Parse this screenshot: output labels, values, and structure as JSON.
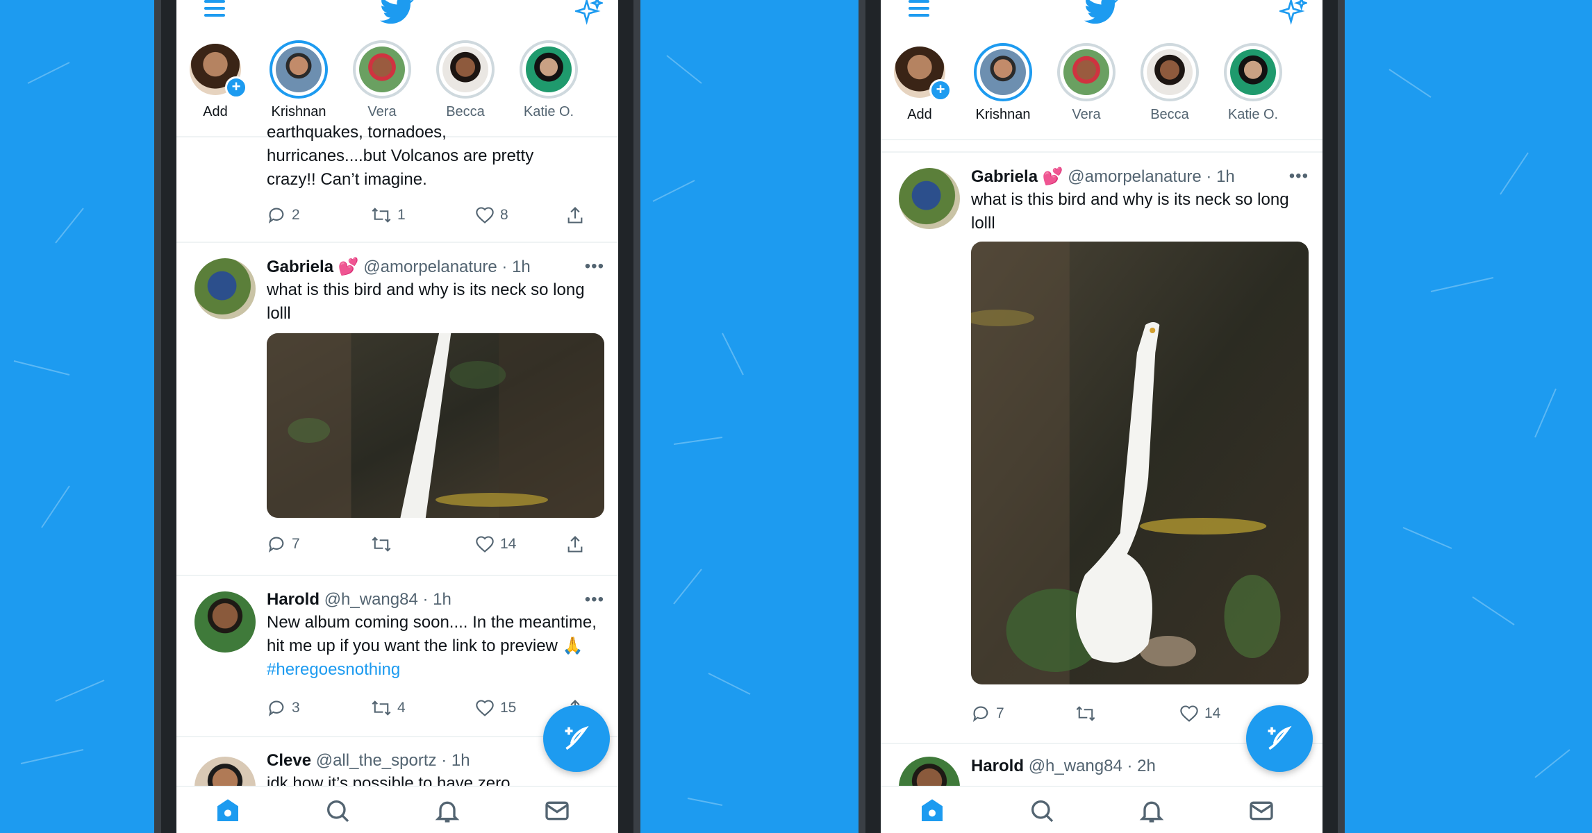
{
  "colors": {
    "brand": "#1d9bf0",
    "background": "#1d9bf0",
    "text": "#0f1419",
    "muted": "#536471"
  },
  "fleets": [
    {
      "name": "Add",
      "has_plus": true
    },
    {
      "name": "Krishnan"
    },
    {
      "name": "Vera"
    },
    {
      "name": "Becca"
    },
    {
      "name": "Katie O."
    }
  ],
  "left": {
    "partial_tweet": {
      "text": "earthquakes, tornadoes,\nhurricanes....but Volcanos are pretty\ncrazy!!  Can’t imagine.",
      "replies": "2",
      "retweets": "1",
      "likes": "8"
    },
    "tweet_gabriela": {
      "name": "Gabriela",
      "emoji": "💕",
      "handle": "@amorpelanature",
      "time": "· 1h",
      "text": "what is this bird and why is its neck so long lolll",
      "replies": "7",
      "retweets": "",
      "likes": "14"
    },
    "tweet_harold": {
      "name": "Harold",
      "handle": "@h_wang84",
      "time": "· 1h",
      "text": "New album coming soon.... In the meantime, hit me up if you want the link to preview 🙏",
      "hashtag": "#heregoesnothing",
      "replies": "3",
      "retweets": "4",
      "likes": "15"
    },
    "tweet_cleve": {
      "name": "Cleve",
      "handle": "@all_the_sportz",
      "time": "· 1h",
      "text": "idk how it’s possible to have zero"
    }
  },
  "right": {
    "tweet_gabriela": {
      "name": "Gabriela",
      "emoji": "💕",
      "handle": "@amorpelanature",
      "time": "· 1h",
      "text": "what is this bird and why is its neck so long lolll",
      "replies": "7",
      "retweets": "",
      "likes": "14"
    },
    "tweet_harold": {
      "name": "Harold",
      "handle": "@h_wang84",
      "time": "· 2h"
    }
  },
  "more_label": "•••",
  "tabs": [
    "home-icon",
    "search-icon",
    "notifications-icon",
    "messages-icon"
  ]
}
